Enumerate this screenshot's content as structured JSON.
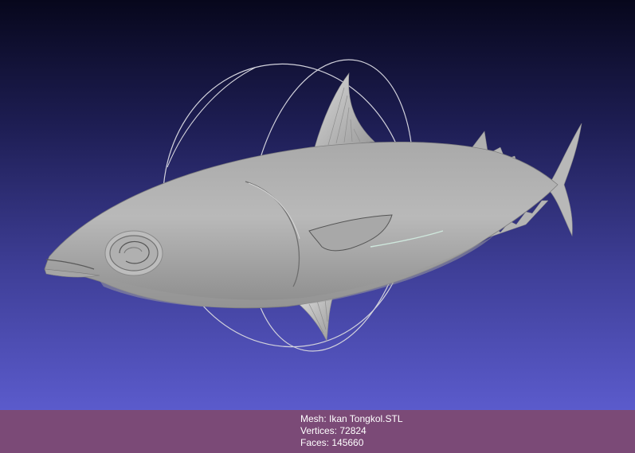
{
  "viewer": {
    "background_top": "#07071c",
    "background_bottom": "#5b5bcc",
    "model_color": "#b5b5b5",
    "trackball_color": "#d0d0d8"
  },
  "info": {
    "background": "#7b4a77",
    "mesh": "Mesh: Ikan Tongkol.STL",
    "vertices": "Vertices: 72824",
    "faces": "Faces: 145660"
  }
}
